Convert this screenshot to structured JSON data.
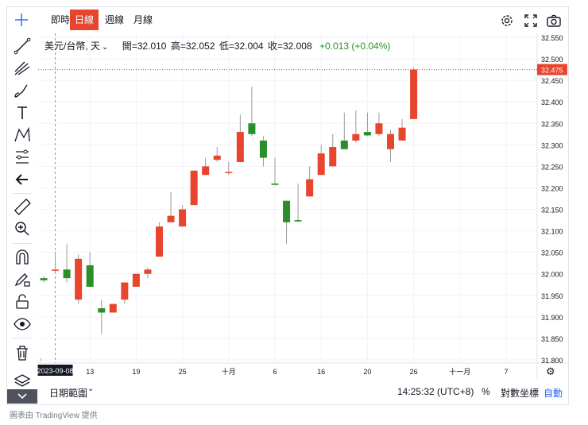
{
  "timeframes": [
    {
      "label": "即時",
      "active": false
    },
    {
      "label": "日線",
      "active": true
    },
    {
      "label": "週線",
      "active": false
    },
    {
      "label": "月線",
      "active": false
    }
  ],
  "legend": {
    "symbol": "美元/台幣, 天",
    "open": "開=32.010",
    "high": "高=32.052",
    "low": "低=32.004",
    "close": "收=32.008",
    "change": "+0.013 (+0.04%)"
  },
  "bottom": {
    "date_range": "日期範圍",
    "time": "14:25:32 (UTC+8)",
    "percent": "%",
    "log": "對數坐標",
    "auto": "自動"
  },
  "footer": "圖表由 TradingView 提供",
  "colors": {
    "up": "#2a8f2a",
    "down": "#e8452c",
    "accent": "#e8452c"
  },
  "chart_data": {
    "type": "candlestick",
    "title": "",
    "y_range": [
      31.8,
      32.55
    ],
    "y_ticks": [
      "32.550",
      "32.500",
      "32.450",
      "32.400",
      "32.350",
      "32.300",
      "32.250",
      "32.200",
      "32.150",
      "32.100",
      "32.050",
      "32.000",
      "31.950",
      "31.900",
      "31.850",
      "31.800"
    ],
    "x_tick_labels": [
      "13",
      "19",
      "25",
      "十月",
      "6",
      "16",
      "20",
      "26",
      "十一月",
      "7"
    ],
    "crosshair_date": "2023-09-08",
    "last_price": "32.475",
    "grid": true,
    "candles": [
      {
        "o": 31.99,
        "h": 31.995,
        "l": 31.98,
        "c": 31.985
      },
      {
        "o": 32.008,
        "h": 32.052,
        "l": 32.004,
        "c": 32.01
      },
      {
        "o": 32.01,
        "h": 32.07,
        "l": 31.98,
        "c": 31.99
      },
      {
        "o": 31.94,
        "h": 32.045,
        "l": 31.93,
        "c": 32.035
      },
      {
        "o": 32.02,
        "h": 32.05,
        "l": 31.97,
        "c": 31.97
      },
      {
        "o": 31.92,
        "h": 31.94,
        "l": 31.86,
        "c": 31.91
      },
      {
        "o": 31.91,
        "h": 31.93,
        "l": 31.91,
        "c": 31.93
      },
      {
        "o": 31.94,
        "h": 31.98,
        "l": 31.93,
        "c": 31.98
      },
      {
        "o": 31.97,
        "h": 32.0,
        "l": 31.97,
        "c": 32.0
      },
      {
        "o": 32.0,
        "h": 32.015,
        "l": 31.99,
        "c": 32.01
      },
      {
        "o": 32.04,
        "h": 32.12,
        "l": 32.04,
        "c": 32.11
      },
      {
        "o": 32.12,
        "h": 32.19,
        "l": 32.12,
        "c": 32.135
      },
      {
        "o": 32.11,
        "h": 32.16,
        "l": 32.11,
        "c": 32.15
      },
      {
        "o": 32.16,
        "h": 32.24,
        "l": 32.16,
        "c": 32.24
      },
      {
        "o": 32.23,
        "h": 32.27,
        "l": 32.23,
        "c": 32.25
      },
      {
        "o": 32.265,
        "h": 32.295,
        "l": 32.26,
        "c": 32.275
      },
      {
        "o": 32.235,
        "h": 32.26,
        "l": 32.23,
        "c": 32.237
      },
      {
        "o": 32.26,
        "h": 32.37,
        "l": 32.26,
        "c": 32.33
      },
      {
        "o": 32.35,
        "h": 32.435,
        "l": 32.32,
        "c": 32.325
      },
      {
        "o": 32.31,
        "h": 32.32,
        "l": 32.25,
        "c": 32.27
      },
      {
        "o": 32.21,
        "h": 32.27,
        "l": 32.205,
        "c": 32.207
      },
      {
        "o": 32.17,
        "h": 32.17,
        "l": 32.07,
        "c": 32.12
      },
      {
        "o": 32.125,
        "h": 32.21,
        "l": 32.12,
        "c": 32.122
      },
      {
        "o": 32.18,
        "h": 32.25,
        "l": 32.18,
        "c": 32.22
      },
      {
        "o": 32.23,
        "h": 32.3,
        "l": 32.23,
        "c": 32.28
      },
      {
        "o": 32.25,
        "h": 32.325,
        "l": 32.25,
        "c": 32.295
      },
      {
        "o": 32.31,
        "h": 32.375,
        "l": 32.29,
        "c": 32.29
      },
      {
        "o": 32.31,
        "h": 32.38,
        "l": 32.305,
        "c": 32.325
      },
      {
        "o": 32.33,
        "h": 32.375,
        "l": 32.32,
        "c": 32.322
      },
      {
        "o": 32.325,
        "h": 32.375,
        "l": 32.32,
        "c": 32.35
      },
      {
        "o": 32.29,
        "h": 32.335,
        "l": 32.26,
        "c": 32.325
      },
      {
        "o": 32.31,
        "h": 32.36,
        "l": 32.31,
        "c": 32.34
      },
      {
        "o": 32.36,
        "h": 32.48,
        "l": 32.36,
        "c": 32.475
      }
    ]
  }
}
